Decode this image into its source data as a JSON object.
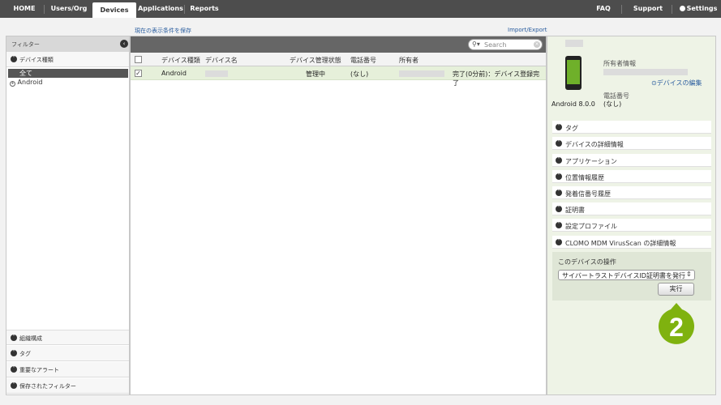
{
  "nav": {
    "tabs": [
      "HOME",
      "Users/Org",
      "Devices",
      "Applications",
      "Reports"
    ],
    "active": "Devices",
    "right": [
      "FAQ",
      "Support",
      "Settings"
    ]
  },
  "links": {
    "save_filter": "現在の表示条件を保存",
    "import_export": "Import/Export"
  },
  "filter": {
    "title": "フィルター",
    "device_type_header": "デバイス種類",
    "items": [
      "全て",
      "Android"
    ],
    "bottom": [
      "組織構成",
      "タグ",
      "重要なアラート",
      "保存されたフィルター"
    ]
  },
  "search": {
    "placeholder": "Search"
  },
  "table": {
    "headers": [
      "デバイス種類",
      "デバイス名",
      "デバイス管理状態",
      "電話番号",
      "所有者"
    ],
    "rows": [
      {
        "type": "Android",
        "status": "管理中",
        "phone": "(なし)",
        "last": "完了(0分前)：デバイス登録完了"
      }
    ]
  },
  "detail": {
    "owner_label": "所有者情報",
    "edit_link": "デバイスの編集",
    "phone_label": "電話番号",
    "phone_value": "(なし)",
    "os": "Android 8.0.0",
    "sections": [
      "タグ",
      "デバイスの詳細情報",
      "アプリケーション",
      "位置情報履歴",
      "発着信番号履歴",
      "証明書",
      "設定プロファイル",
      "CLOMO MDM VirusScan の詳細情報"
    ],
    "ops_title": "このデバイスの操作",
    "ops_select": "サイバートラストデバイスID証明書を発行",
    "run": "実行"
  },
  "badge": "2",
  "colors": {
    "accent_green": "#7fb20f",
    "nav_bg": "#4d4d4d"
  }
}
